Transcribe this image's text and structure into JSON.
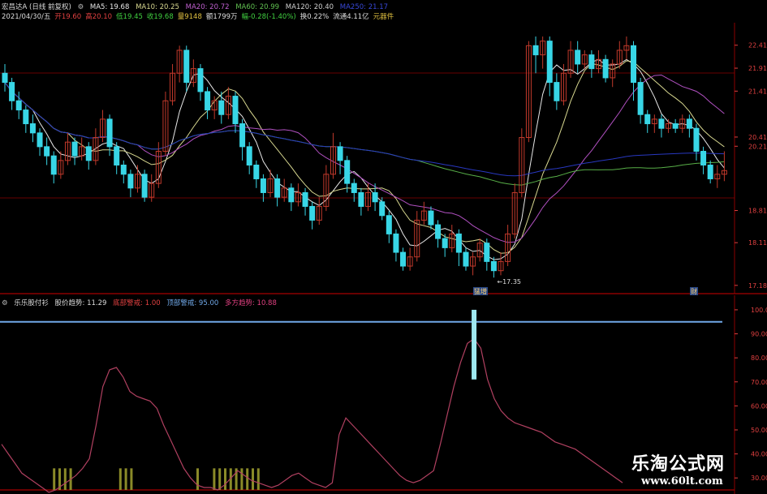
{
  "header": {
    "title": "宏昌达A (日线 前复权)",
    "ma5": "MA5: 19.68",
    "ma10": "MA10: 20.25",
    "ma20": "MA20: 20.72",
    "ma60": "MA60: 20.99",
    "ma120": "MA120: 20.40",
    "ma250": "MA250: 21.17",
    "date": "2021/04/30/五",
    "open": "开19.60",
    "high": "高20.10",
    "low": "低19.45",
    "close": "收19.68",
    "volume": "量9148",
    "amount": "额1799万",
    "change": "幅-0.28(-1.40%)",
    "turnover": "换0.22%",
    "float_cap": "流通4.11亿",
    "sector": "元器件"
  },
  "indicator": {
    "name": "乐乐股付衫",
    "trend": "股价趋势: 11.29",
    "bottom_warn": "底部警戒: 1.00",
    "top_warn": "顶部警戒: 95.00",
    "bull_trend": "多方趋势: 10.88"
  },
  "watermark": {
    "name": "乐淘公式网",
    "url": "www.60lt.com"
  },
  "colors": {
    "up": "#c0392b",
    "down": "#38d6e6",
    "ma5": "#e8e8e8",
    "ma10": "#d8d890",
    "ma20": "#b050c0",
    "ma60": "#58b048",
    "ma120": "#2838c0",
    "osc": "#b04060",
    "level": "#70a8e8",
    "bars": "#8a8a28",
    "grid": "#8b0000"
  },
  "chart_data": [
    {
      "type": "candlestick",
      "ylim": [
        17.0,
        22.9
      ],
      "y_ticks": [
        "22.41",
        "21.91",
        "21.41",
        "20.41",
        "20.21",
        "18.81",
        "18.11",
        "17.18"
      ],
      "annotations": [
        {
          "text": "←17.35",
          "label_for": "low"
        },
        {
          "text": "猛增",
          "label_for": "event"
        },
        {
          "text": "财",
          "label_for": "event"
        }
      ],
      "ma_current": {
        "MA5": 19.68,
        "MA10": 20.25,
        "MA20": 20.72,
        "MA60": 20.99,
        "MA120": 20.4,
        "MA250": 21.17
      },
      "candles": [
        [
          21.8,
          21.6,
          22.0,
          21.4
        ],
        [
          21.6,
          21.2,
          21.7,
          21.0
        ],
        [
          21.2,
          21.0,
          21.4,
          20.8
        ],
        [
          21.0,
          20.7,
          21.1,
          20.5
        ],
        [
          20.7,
          20.5,
          20.9,
          20.3
        ],
        [
          20.5,
          20.2,
          20.6,
          20.0
        ],
        [
          20.2,
          20.0,
          20.4,
          19.8
        ],
        [
          20.0,
          19.6,
          20.1,
          19.4
        ],
        [
          19.6,
          19.9,
          20.1,
          19.5
        ],
        [
          19.9,
          20.3,
          20.5,
          19.8
        ],
        [
          20.3,
          20.0,
          20.4,
          19.8
        ],
        [
          20.0,
          20.2,
          20.4,
          19.9
        ],
        [
          20.2,
          19.9,
          20.3,
          19.7
        ],
        [
          19.9,
          20.4,
          20.6,
          19.8
        ],
        [
          20.4,
          20.8,
          21.0,
          20.3
        ],
        [
          20.8,
          20.2,
          20.9,
          20.0
        ],
        [
          20.2,
          19.8,
          20.3,
          19.6
        ],
        [
          19.8,
          19.6,
          19.9,
          19.4
        ],
        [
          19.6,
          19.3,
          19.7,
          19.1
        ],
        [
          19.3,
          19.6,
          19.8,
          19.2
        ],
        [
          19.6,
          19.1,
          19.7,
          19.0
        ],
        [
          19.1,
          19.4,
          19.6,
          19.0
        ],
        [
          19.4,
          20.1,
          20.3,
          19.3
        ],
        [
          20.1,
          21.2,
          21.4,
          20.0
        ],
        [
          21.2,
          21.8,
          22.0,
          21.1
        ],
        [
          21.8,
          22.3,
          22.4,
          21.6
        ],
        [
          22.3,
          21.6,
          22.4,
          21.4
        ],
        [
          21.6,
          21.9,
          22.1,
          21.5
        ],
        [
          21.9,
          21.4,
          22.0,
          21.2
        ],
        [
          21.4,
          21.0,
          21.5,
          20.8
        ],
        [
          21.0,
          21.2,
          21.3,
          20.8
        ],
        [
          21.2,
          20.9,
          21.4,
          20.7
        ],
        [
          20.9,
          21.3,
          21.5,
          20.8
        ],
        [
          21.3,
          20.7,
          21.4,
          20.5
        ],
        [
          20.7,
          20.2,
          20.8,
          19.9
        ],
        [
          20.2,
          19.8,
          20.3,
          19.6
        ],
        [
          19.8,
          19.5,
          19.9,
          19.3
        ],
        [
          19.5,
          19.2,
          19.6,
          19.0
        ],
        [
          19.2,
          19.5,
          19.7,
          19.1
        ],
        [
          19.5,
          19.1,
          19.6,
          18.9
        ],
        [
          19.1,
          19.3,
          19.5,
          19.0
        ],
        [
          19.3,
          19.0,
          19.4,
          18.8
        ],
        [
          19.0,
          19.2,
          19.4,
          18.9
        ],
        [
          19.2,
          18.9,
          19.3,
          18.7
        ],
        [
          18.9,
          18.6,
          19.0,
          18.4
        ],
        [
          18.6,
          18.9,
          19.1,
          18.5
        ],
        [
          18.9,
          19.6,
          19.8,
          18.8
        ],
        [
          19.6,
          20.2,
          20.5,
          19.5
        ],
        [
          20.2,
          19.9,
          20.3,
          19.6
        ],
        [
          19.9,
          19.4,
          20.0,
          19.2
        ],
        [
          19.4,
          19.2,
          19.5,
          19.0
        ],
        [
          19.2,
          18.9,
          19.3,
          18.7
        ],
        [
          18.9,
          19.2,
          19.4,
          18.8
        ],
        [
          19.2,
          19.0,
          19.4,
          18.8
        ],
        [
          19.0,
          18.7,
          19.1,
          18.6
        ],
        [
          18.7,
          18.3,
          18.8,
          18.1
        ],
        [
          18.3,
          17.9,
          18.4,
          17.7
        ],
        [
          17.9,
          17.6,
          18.0,
          17.5
        ],
        [
          17.6,
          17.8,
          18.0,
          17.5
        ],
        [
          17.8,
          18.6,
          18.8,
          17.7
        ],
        [
          18.6,
          18.8,
          19.0,
          18.5
        ],
        [
          18.8,
          18.5,
          18.9,
          18.4
        ],
        [
          18.5,
          18.2,
          18.6,
          18.0
        ],
        [
          18.2,
          18.0,
          18.3,
          17.8
        ],
        [
          18.0,
          18.3,
          18.5,
          17.9
        ],
        [
          18.3,
          17.9,
          18.4,
          17.6
        ],
        [
          17.9,
          17.6,
          18.0,
          17.5
        ],
        [
          17.6,
          17.8,
          17.9,
          17.4
        ],
        [
          17.8,
          18.1,
          18.2,
          17.7
        ],
        [
          18.1,
          17.7,
          18.2,
          17.5
        ],
        [
          17.7,
          17.5,
          17.8,
          17.35
        ],
        [
          17.5,
          17.7,
          17.9,
          17.4
        ],
        [
          17.7,
          18.3,
          18.5,
          17.6
        ],
        [
          18.3,
          19.2,
          19.4,
          18.2
        ],
        [
          19.2,
          20.4,
          20.6,
          19.1
        ],
        [
          20.4,
          22.4,
          22.5,
          20.3
        ],
        [
          22.4,
          22.2,
          22.6,
          21.8
        ],
        [
          22.2,
          22.5,
          22.6,
          21.9
        ],
        [
          22.5,
          21.6,
          22.6,
          21.3
        ],
        [
          21.6,
          21.2,
          21.8,
          21.0
        ],
        [
          21.2,
          21.8,
          22.0,
          21.1
        ],
        [
          21.8,
          22.3,
          22.5,
          21.7
        ],
        [
          22.3,
          22.0,
          22.5,
          21.8
        ],
        [
          22.0,
          22.2,
          22.3,
          21.9
        ],
        [
          22.2,
          21.9,
          22.3,
          21.7
        ],
        [
          21.9,
          22.1,
          22.3,
          21.8
        ],
        [
          22.1,
          21.7,
          22.2,
          21.6
        ],
        [
          21.7,
          22.0,
          22.1,
          21.5
        ],
        [
          22.0,
          22.3,
          22.5,
          21.9
        ],
        [
          22.3,
          22.4,
          22.6,
          22.1
        ],
        [
          22.4,
          21.6,
          22.5,
          21.2
        ],
        [
          21.6,
          20.9,
          21.7,
          20.7
        ],
        [
          20.9,
          20.7,
          21.0,
          20.5
        ],
        [
          20.7,
          20.8,
          20.9,
          20.5
        ],
        [
          20.8,
          20.6,
          20.9,
          20.4
        ],
        [
          20.6,
          20.7,
          20.8,
          20.5
        ],
        [
          20.7,
          20.6,
          20.8,
          20.5
        ],
        [
          20.6,
          20.8,
          20.9,
          20.5
        ],
        [
          20.8,
          20.6,
          20.9,
          20.4
        ],
        [
          20.6,
          20.1,
          20.7,
          19.9
        ],
        [
          20.1,
          19.8,
          20.2,
          19.6
        ],
        [
          19.8,
          19.5,
          19.9,
          19.4
        ],
        [
          19.5,
          19.6,
          19.8,
          19.3
        ],
        [
          19.6,
          19.68,
          20.1,
          19.45
        ]
      ]
    },
    {
      "type": "line",
      "ylim": [
        25,
        102
      ],
      "y_ticks": [
        "100.00",
        "90.00",
        "80.00",
        "70.00",
        "60.00",
        "50.00",
        "40.00",
        "30.00"
      ],
      "top_level": 95.0,
      "values": [
        44,
        40,
        36,
        32,
        30,
        28,
        26,
        24,
        25,
        27,
        29,
        31,
        34,
        38,
        52,
        68,
        75,
        76,
        72,
        66,
        64,
        63,
        62,
        59,
        52,
        46,
        40,
        34,
        30,
        27,
        26,
        26,
        25,
        27,
        30,
        33,
        31,
        29,
        28,
        27,
        26,
        27,
        29,
        31,
        32,
        30,
        28,
        27,
        26,
        28,
        48,
        55,
        52,
        49,
        46,
        43,
        40,
        37,
        34,
        31,
        29,
        28,
        29,
        31,
        33,
        44,
        56,
        68,
        78,
        86,
        88,
        84,
        71,
        63,
        58,
        55,
        53,
        52,
        51,
        50,
        49,
        47,
        45,
        44,
        43,
        42,
        40,
        38,
        36,
        34,
        32,
        30,
        28
      ],
      "signal_spike": {
        "index": 70,
        "from": 71,
        "to": 100
      },
      "bottom_bars": [
        4,
        5,
        6,
        7,
        16,
        17,
        18,
        30,
        33,
        34,
        35,
        36,
        37,
        38,
        39,
        40,
        41
      ]
    }
  ]
}
